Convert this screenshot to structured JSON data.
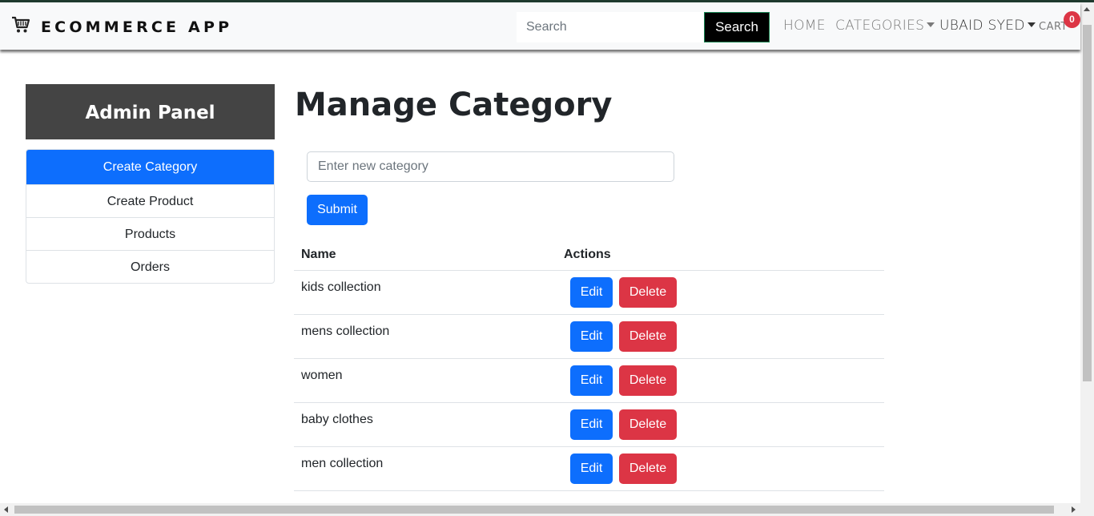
{
  "navbar": {
    "brand": "ECOMMERCE APP",
    "brand_icon": "shopping-cart-icon",
    "search_placeholder": "Search",
    "search_button": "Search",
    "home": "HOME",
    "categories": "CATEGORIES",
    "user": "UBAID SYED",
    "cart": "CART",
    "cart_count": "0"
  },
  "sidebar": {
    "title": "Admin Panel",
    "items": [
      {
        "label": "Create Category",
        "active": true
      },
      {
        "label": "Create Product",
        "active": false
      },
      {
        "label": "Products",
        "active": false
      },
      {
        "label": "Orders",
        "active": false
      }
    ]
  },
  "main": {
    "title": "Manage Category",
    "input_placeholder": "Enter new category",
    "submit": "Submit",
    "table": {
      "headers": [
        "Name",
        "Actions"
      ],
      "edit_label": "Edit",
      "delete_label": "Delete",
      "rows": [
        "kids collection",
        "mens collection",
        "women",
        "baby clothes",
        "men collection"
      ]
    }
  },
  "colors": {
    "primary": "#0d6efd",
    "danger": "#dc3545",
    "sidebar_header": "#444444"
  }
}
